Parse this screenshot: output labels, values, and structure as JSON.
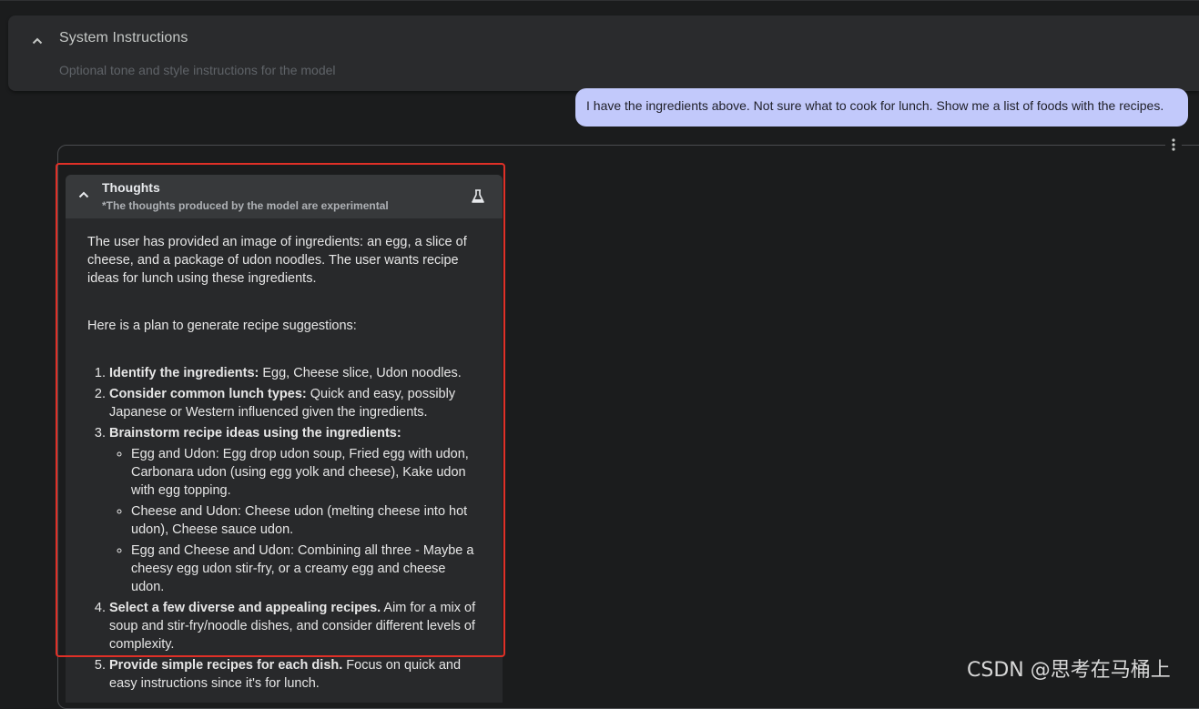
{
  "system_instructions": {
    "title": "System Instructions",
    "placeholder": "Optional tone and style instructions for the model"
  },
  "user_message": "I have the ingredients above. Not sure what to cook for lunch. Show me a list of foods with the recipes.",
  "thoughts": {
    "title": "Thoughts",
    "subtitle": "*The thoughts produced by the model are experimental",
    "paragraphs": [
      "The user has provided an image of ingredients: an egg, a slice of cheese, and a package of udon noodles. The user wants recipe ideas for lunch using these ingredients.",
      "Here is a plan to generate recipe suggestions:"
    ],
    "steps": [
      {
        "bold": "Identify the ingredients:",
        "text": " Egg, Cheese slice, Udon noodles."
      },
      {
        "bold": "Consider common lunch types:",
        "text": " Quick and easy, possibly Japanese or Western influenced given the ingredients."
      },
      {
        "bold": "Brainstorm recipe ideas using the ingredients:",
        "text": "",
        "sub": [
          "Egg and Udon: Egg drop udon soup, Fried egg with udon, Carbonara udon (using egg yolk and cheese), Kake udon with egg topping.",
          "Cheese and Udon: Cheese udon (melting cheese into hot udon), Cheese sauce udon.",
          "Egg and Cheese and Udon: Combining all three - Maybe a cheesy egg udon stir-fry, or a creamy egg and cheese udon."
        ]
      },
      {
        "bold": "Select a few diverse and appealing recipes.",
        "text": " Aim for a mix of soup and stir-fry/noodle dishes, and consider different levels of complexity."
      },
      {
        "bold": "Provide simple recipes for each dish.",
        "text": " Focus on quick and easy instructions since it's for lunch."
      }
    ]
  },
  "watermark": "CSDN @思考在马桶上",
  "icons": {
    "collapse": "chevron-up-icon",
    "experimental": "flask-icon",
    "more": "more-vert-icon"
  },
  "colors": {
    "background": "#1b1c1d",
    "user_bubble": "#c2c9fb",
    "highlight": "#e03027"
  }
}
